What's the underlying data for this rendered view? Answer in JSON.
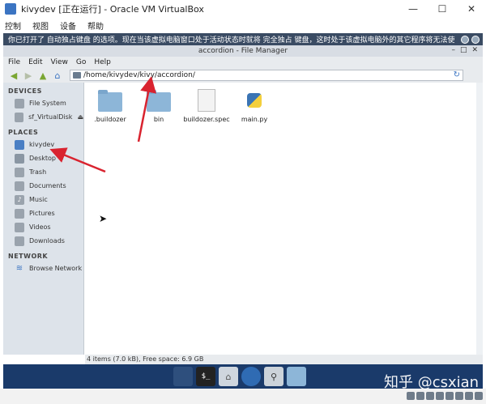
{
  "vbox": {
    "title": "kivydev [正在运行] - Oracle VM VirtualBox",
    "menus": [
      "控制",
      "视图",
      "设备",
      "帮助"
    ],
    "notice": "你已打开了 自动独占键盘 的选项。现在当该虚拟电脑窗口处于活动状态时就将 完全独占 键盘，这时处于该虚拟电脑外的其它程序将无法使",
    "window_buttons": [
      "—",
      "☐",
      "✕"
    ]
  },
  "fm": {
    "title": "accordion - File Manager",
    "menus": [
      "File",
      "Edit",
      "View",
      "Go",
      "Help"
    ],
    "path": "/home/kivydev/kivy/accordion/",
    "sidebar": {
      "devices_header": "DEVICES",
      "devices": [
        "File System",
        "sf_VirtualDisk"
      ],
      "places_header": "PLACES",
      "places": [
        "kivydev",
        "Desktop",
        "Trash",
        "Documents",
        "Music",
        "Pictures",
        "Videos",
        "Downloads"
      ],
      "network_header": "NETWORK",
      "network": [
        "Browse Network"
      ]
    },
    "files": [
      {
        "name": ".buildozer",
        "type": "folder"
      },
      {
        "name": "bin",
        "type": "folder"
      },
      {
        "name": "buildozer.spec",
        "type": "document"
      },
      {
        "name": "main.py",
        "type": "python"
      }
    ],
    "status": "4 items (7.0 kB), Free space: 6.9 GB"
  },
  "watermark": "知乎 @csxian",
  "colors": {
    "arrow": "#d9232f",
    "dock": "#1a3a6a",
    "sidebar": "#dde3ea",
    "notice": "#3a4b63"
  }
}
